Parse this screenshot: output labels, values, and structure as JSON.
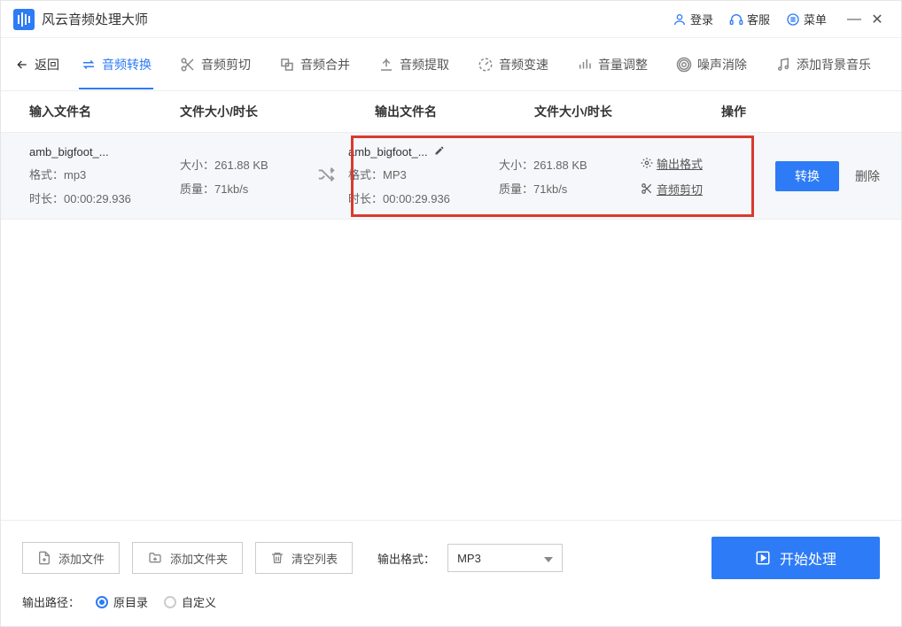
{
  "titlebar": {
    "app_title": "风云音频处理大师",
    "login": "登录",
    "support": "客服",
    "menu": "菜单"
  },
  "tabs": {
    "back": "返回",
    "convert": "音频转换",
    "cut": "音频剪切",
    "merge": "音频合并",
    "extract": "音频提取",
    "speed": "音频变速",
    "volume": "音量调整",
    "noise": "噪声消除",
    "bgm": "添加背景音乐"
  },
  "thead": {
    "in_name": "输入文件名",
    "in_meta": "文件大小/时长",
    "out_name": "输出文件名",
    "out_meta": "文件大小/时长",
    "ops": "操作"
  },
  "row": {
    "in_name": "amb_bigfoot_...",
    "in_format": "格式：mp3",
    "in_duration": "时长：00:00:29.936",
    "in_size": "大小：261.88 KB",
    "in_quality": "质量：71kb/s",
    "out_name": "amb_bigfoot_...",
    "out_format": "格式：MP3",
    "out_duration": "时长：00:00:29.936",
    "out_size": "大小：261.88 KB",
    "out_quality": "质量：71kb/s",
    "op_format": "输出格式",
    "op_cut": "音频剪切",
    "convert": "转换",
    "delete": "删除"
  },
  "bottom": {
    "add_file": "添加文件",
    "add_folder": "添加文件夹",
    "clear": "清空列表",
    "out_format_label": "输出格式：",
    "out_format_value": "MP3",
    "start": "开始处理",
    "out_path_label": "输出路径：",
    "radio_same": "原目录",
    "radio_custom": "自定义"
  }
}
